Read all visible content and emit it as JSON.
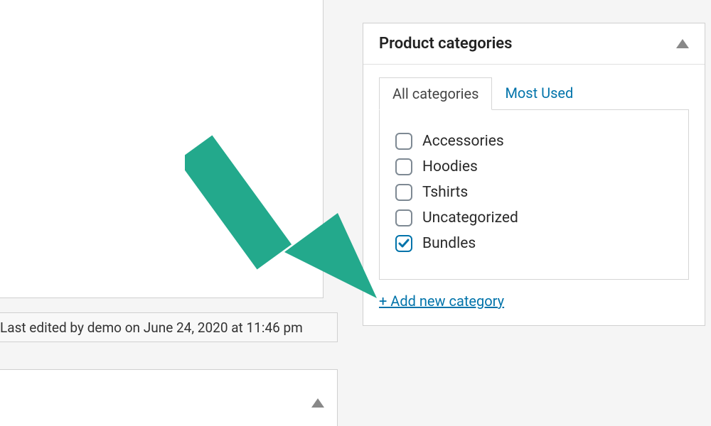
{
  "status": {
    "text": "Last edited by demo on June 24, 2020 at 11:46 pm"
  },
  "sidebar": {
    "title": "Product categories",
    "tabs": {
      "all": "All categories",
      "most_used": "Most Used"
    },
    "categories": [
      {
        "label": "Accessories",
        "checked": false
      },
      {
        "label": "Hoodies",
        "checked": false
      },
      {
        "label": "Tshirts",
        "checked": false
      },
      {
        "label": "Uncategorized",
        "checked": false
      },
      {
        "label": "Bundles",
        "checked": true
      }
    ],
    "add_new": "+ Add new category"
  }
}
